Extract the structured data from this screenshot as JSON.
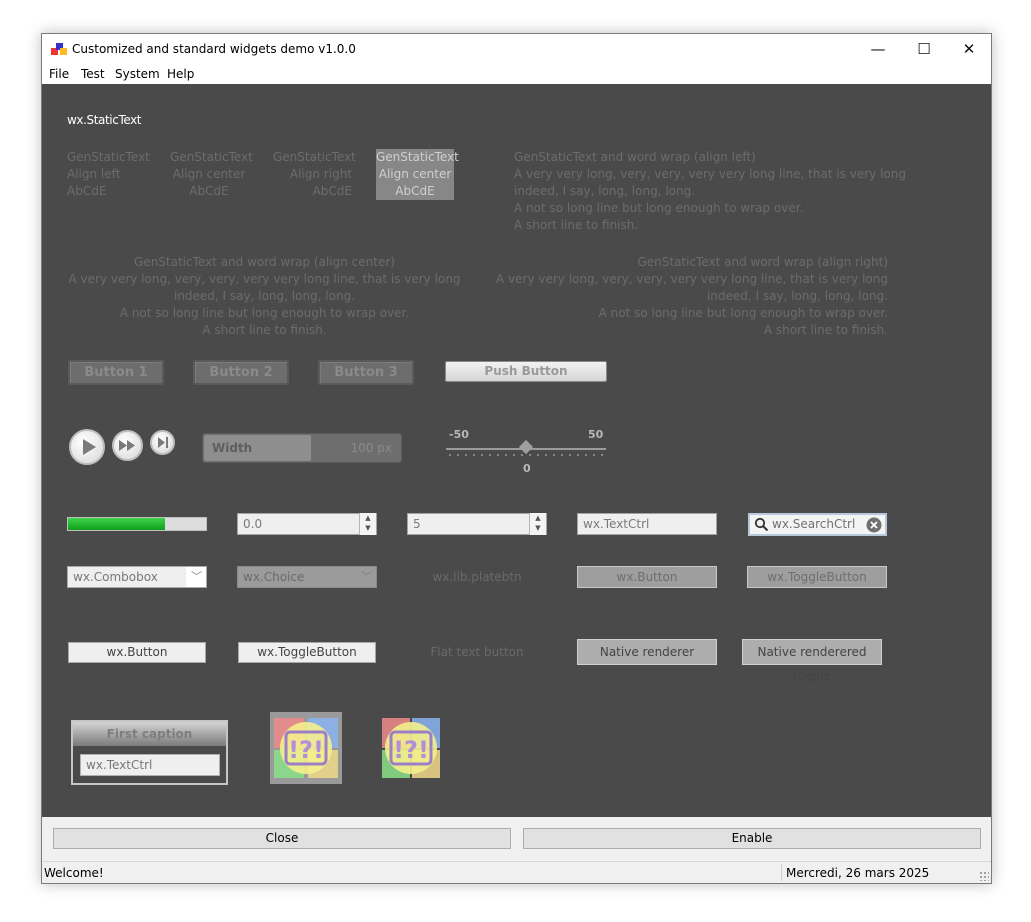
{
  "window": {
    "title": "Customized and standard widgets demo v1.0.0",
    "controls": {
      "minimize": "—",
      "maximize": "☐",
      "close": "✕"
    }
  },
  "menu": [
    "File",
    "Test",
    "System",
    "Help"
  ],
  "static_text": "wx.StaticText",
  "gen_static": [
    {
      "lines": [
        "GenStaticText",
        "Align left",
        "AbCdE"
      ]
    },
    {
      "lines": [
        "GenStaticText",
        "Align center",
        "AbCdE"
      ]
    },
    {
      "lines": [
        "GenStaticText",
        "Align right",
        "AbCdE"
      ]
    },
    {
      "lines": [
        "GenStaticText",
        "Align center",
        "AbCdE"
      ]
    }
  ],
  "wrap_left": [
    "GenStaticText and word wrap (align left)",
    "A very very long, very, very, very very long line, that is very long",
    "indeed, I say, long, long, long.",
    "A not so long line but long enough to wrap over.",
    "A short line to finish."
  ],
  "wrap_center": [
    "GenStaticText and word wrap (align center)",
    "A very very long, very, very, very very long line, that is very long",
    "indeed, I say, long, long, long.",
    "A not so long line but long enough to wrap over.",
    "A short line to finish."
  ],
  "wrap_right": [
    "GenStaticText and word wrap (align right)",
    "A very very long, very, very, very very long line, that is very long",
    "indeed, I say, long, long, long.",
    "A not so long line but long enough to wrap over.",
    "A short line to finish."
  ],
  "gen_buttons": [
    "Button 1",
    "Button 2",
    "Button 3"
  ],
  "push_button": "Push Button",
  "width_slider": {
    "label": "Width",
    "value_text": "100 px",
    "fill_fraction": 0.54
  },
  "h_slider": {
    "min": "-50",
    "max": "50",
    "value": "0"
  },
  "gauge": {
    "fill_fraction": 0.7
  },
  "spin_float": "0.0",
  "spin_int": "5",
  "text_ctrl": "wx.TextCtrl",
  "search_ctrl": "wx.SearchCtrl",
  "combobox": "wx.Combobox",
  "choice": "wx.Choice",
  "platebtn": "wx.lib.platebtn",
  "wx_button": "wx.Button",
  "wx_toggle": "wx.ToggleButton",
  "wx_button2": "wx.Button",
  "wx_toggle2": "wx.ToggleButton",
  "flat_text_button": "Flat text button",
  "native_renderer": "Native renderer",
  "native_toggle": "Native renderered toggle",
  "caption_panel": {
    "caption": "First caption",
    "field": "wx.TextCtrl"
  },
  "bitmap_text": "!?!",
  "close_button": "Close",
  "enable_button": "Enable",
  "status": {
    "left": "Welcome!",
    "right": "Mercredi, 26 mars 2025"
  }
}
